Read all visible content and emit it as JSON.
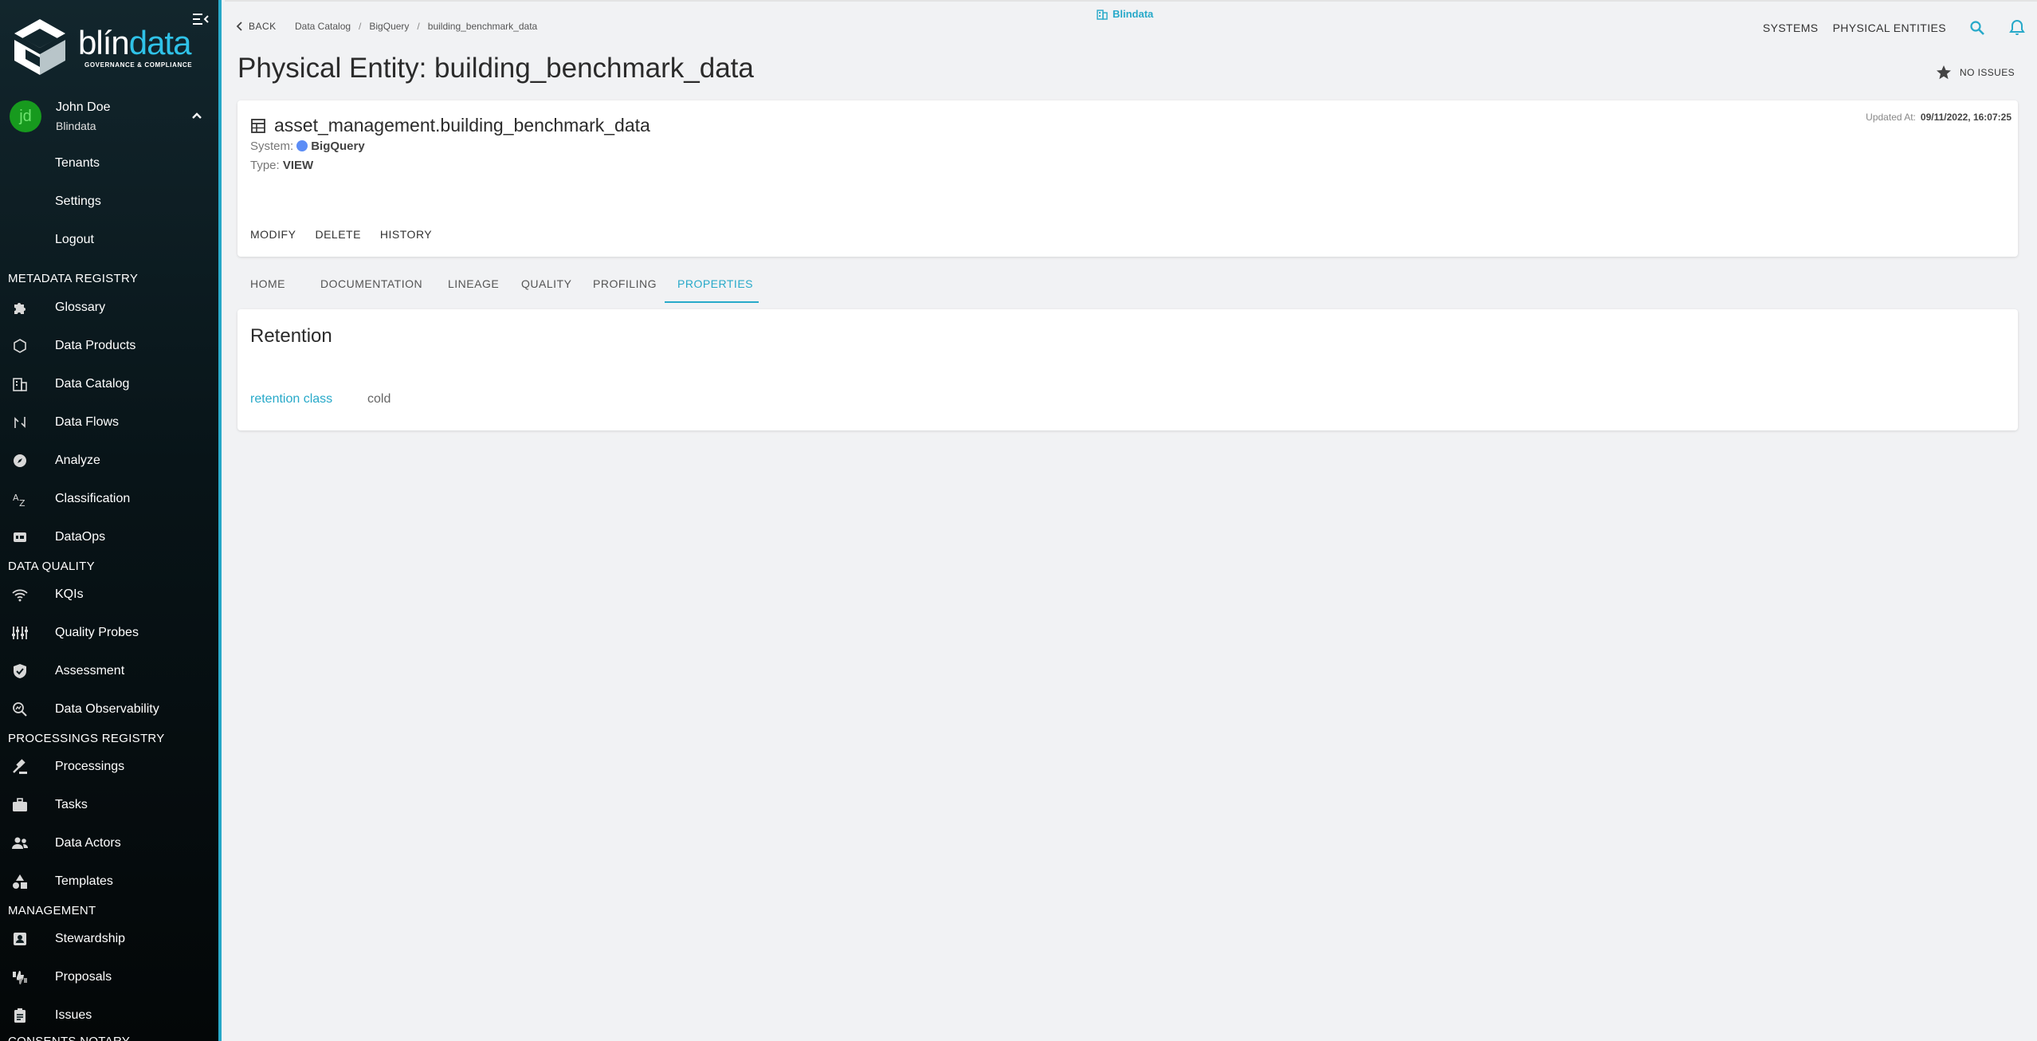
{
  "sidebar": {
    "brand": {
      "name_plain": "blín",
      "name_accent": "data",
      "tagline": "GOVERNANCE & COMPLIANCE"
    },
    "user": {
      "initials": "jd",
      "name": "John Doe",
      "tenant": "Blindata"
    },
    "user_menu": [
      "Tenants",
      "Settings",
      "Logout"
    ],
    "sections": [
      {
        "title": "METADATA REGISTRY",
        "items": [
          {
            "label": "Glossary",
            "icon": "puzzle-icon"
          },
          {
            "label": "Data Products",
            "icon": "hexagon-icon"
          },
          {
            "label": "Data Catalog",
            "icon": "building-icon"
          },
          {
            "label": "Data Flows",
            "icon": "flow-icon"
          },
          {
            "label": "Analyze",
            "icon": "compass-icon"
          },
          {
            "label": "Classification",
            "icon": "sort-az-icon"
          },
          {
            "label": "DataOps",
            "icon": "devops-icon"
          }
        ]
      },
      {
        "title": "DATA QUALITY",
        "items": [
          {
            "label": "KQIs",
            "icon": "wifi-icon"
          },
          {
            "label": "Quality Probes",
            "icon": "sliders-icon"
          },
          {
            "label": "Assessment",
            "icon": "shield-check-icon"
          },
          {
            "label": "Data Observability",
            "icon": "magnify-graph-icon"
          }
        ]
      },
      {
        "title": "PROCESSINGS REGISTRY",
        "items": [
          {
            "label": "Processings",
            "icon": "gavel-icon"
          },
          {
            "label": "Tasks",
            "icon": "briefcase-icon"
          },
          {
            "label": "Data Actors",
            "icon": "people-icon"
          },
          {
            "label": "Templates",
            "icon": "shapes-icon"
          }
        ]
      },
      {
        "title": "MANAGEMENT",
        "items": [
          {
            "label": "Stewardship",
            "icon": "badge-icon"
          },
          {
            "label": "Proposals",
            "icon": "thumbs-icon"
          },
          {
            "label": "Issues",
            "icon": "clipboard-icon"
          }
        ]
      },
      {
        "title": "CONSENTS NOTARY",
        "items": []
      }
    ]
  },
  "header": {
    "back_label": "BACK",
    "breadcrumb": [
      "Data Catalog",
      "BigQuery",
      "building_benchmark_data"
    ],
    "tenant": "Blindata",
    "links": [
      "SYSTEMS",
      "PHYSICAL ENTITIES"
    ],
    "accent_color": "#27a9c9"
  },
  "page": {
    "title": "Physical Entity: building_benchmark_data",
    "issues_label": "NO ISSUES"
  },
  "entity": {
    "name": "asset_management.building_benchmark_data",
    "system_label": "System:",
    "system_value": "BigQuery",
    "type_label": "Type:",
    "type_value": "VIEW",
    "updated_label": "Updated At:",
    "updated_value": "09/11/2022, 16:07:25",
    "actions": [
      "MODIFY",
      "DELETE",
      "HISTORY"
    ]
  },
  "tabs": [
    "HOME",
    "DOCUMENTATION",
    "LINEAGE",
    "QUALITY",
    "PROFILING",
    "PROPERTIES"
  ],
  "active_tab": "PROPERTIES",
  "properties": {
    "title": "Retention",
    "key": "retention class",
    "value": "cold"
  }
}
